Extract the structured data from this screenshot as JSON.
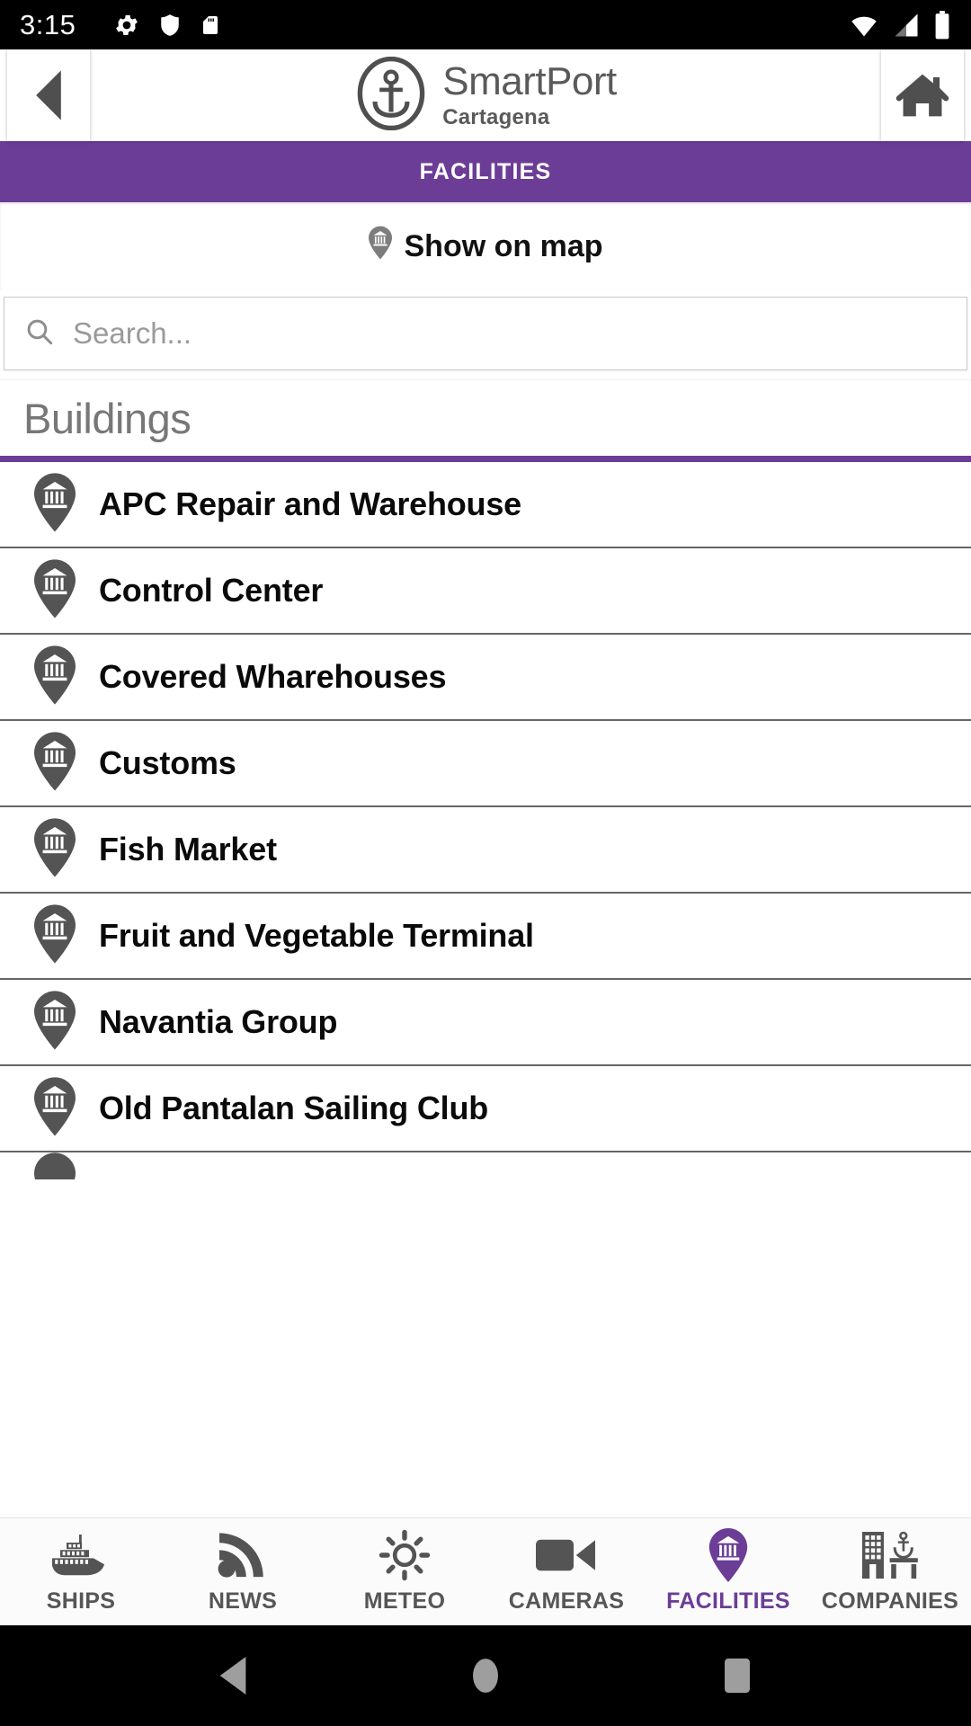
{
  "status_bar": {
    "time": "3:15",
    "left_icons": [
      "gear-icon",
      "shield-icon",
      "sd-card-icon"
    ],
    "right_icons": [
      "wifi-icon",
      "cellular-signal-icon",
      "battery-icon"
    ]
  },
  "header": {
    "back_label": "Back",
    "home_label": "Home",
    "logo_name": "anchor-logo",
    "title": "SmartPort",
    "subtitle": "Cartagena"
  },
  "section": {
    "banner_title": "FACILITIES",
    "accent_color": "#6b3d96"
  },
  "show_on_map": {
    "label": "Show on map",
    "icon": "map-pin-building-icon"
  },
  "search": {
    "placeholder": "Search...",
    "value": "",
    "icon": "search-icon"
  },
  "group": {
    "title": "Buildings"
  },
  "list": {
    "item_icon": "map-pin-building-icon",
    "items": [
      {
        "label": "APC Repair and Warehouse"
      },
      {
        "label": "Control Center"
      },
      {
        "label": "Covered Wharehouses"
      },
      {
        "label": "Customs"
      },
      {
        "label": "Fish Market"
      },
      {
        "label": "Fruit and Vegetable Terminal"
      },
      {
        "label": "Navantia Group"
      },
      {
        "label": "Old Pantalan Sailing Club"
      }
    ]
  },
  "tabs": [
    {
      "label": "SHIPS",
      "icon": "ship-icon",
      "active": false
    },
    {
      "label": "NEWS",
      "icon": "rss-icon",
      "active": false
    },
    {
      "label": "METEO",
      "icon": "sun-icon",
      "active": false
    },
    {
      "label": "CAMERAS",
      "icon": "video-camera-icon",
      "active": false
    },
    {
      "label": "FACILITIES",
      "icon": "map-pin-building-icon",
      "active": true
    },
    {
      "label": "COMPANIES",
      "icon": "buildings-anchor-icon",
      "active": false
    }
  ],
  "system_nav": {
    "back_label": "Back",
    "home_label": "Home",
    "recents_label": "Recents"
  }
}
